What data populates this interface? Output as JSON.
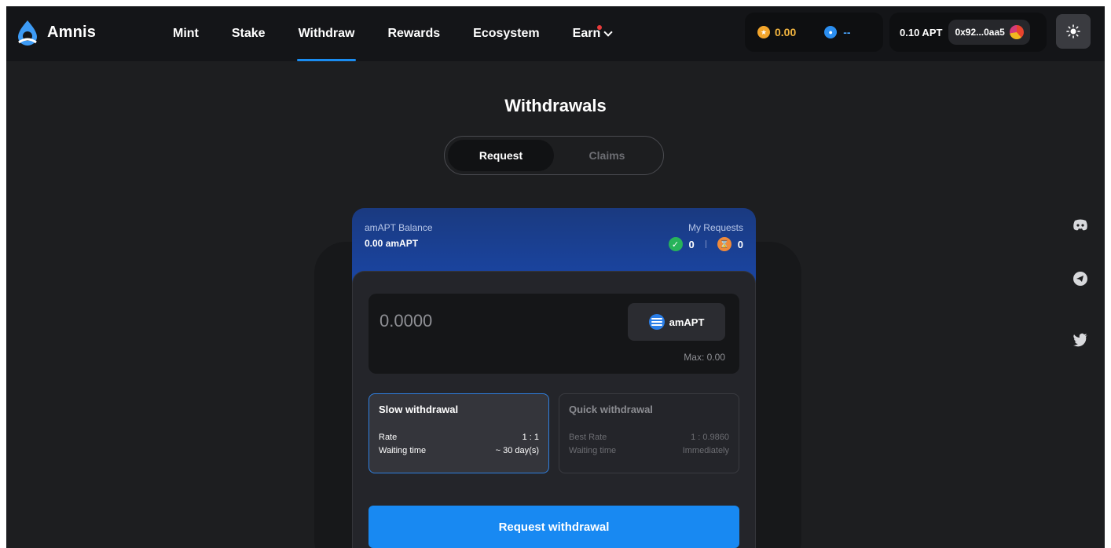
{
  "header": {
    "brand": "Amnis",
    "nav": [
      {
        "label": "Mint",
        "active": false
      },
      {
        "label": "Stake",
        "active": false
      },
      {
        "label": "Withdraw",
        "active": true
      },
      {
        "label": "Rewards",
        "active": false
      },
      {
        "label": "Ecosystem",
        "active": false
      },
      {
        "label": "Earn",
        "active": false
      }
    ],
    "points": {
      "gold_value": "0.00",
      "blue_value": "--"
    },
    "wallet": {
      "apt_balance": "0.10 APT",
      "address": "0x92...0aa5"
    },
    "theme_icon": "sun-icon"
  },
  "page": {
    "title": "Withdrawals",
    "tabs": [
      {
        "label": "Request",
        "active": true
      },
      {
        "label": "Claims",
        "active": false
      }
    ]
  },
  "summary": {
    "balance_label": "amAPT Balance",
    "balance_value": "0.00 amAPT",
    "requests_label": "My Requests",
    "completed_count": "0",
    "pending_count": "0"
  },
  "form": {
    "amount_placeholder": "0.0000",
    "token": "amAPT",
    "max_text": "Max: 0.00",
    "options": [
      {
        "title": "Slow withdrawal",
        "rows": [
          [
            "Rate",
            "1 : 1"
          ],
          [
            "Waiting time",
            "~ 30 day(s)"
          ]
        ],
        "selected": true
      },
      {
        "title": "Quick withdrawal",
        "rows": [
          [
            "Best Rate",
            "1 : 0.9860"
          ],
          [
            "Waiting time",
            "Immediately"
          ]
        ],
        "selected": false
      }
    ],
    "submit_label": "Request withdrawal"
  },
  "social": [
    "discord-icon",
    "telegram-icon",
    "twitter-icon"
  ],
  "colors": {
    "accent": "#1889f2",
    "background": "#1d1e20",
    "header": "#141518",
    "card_top": "#1a49b0"
  }
}
